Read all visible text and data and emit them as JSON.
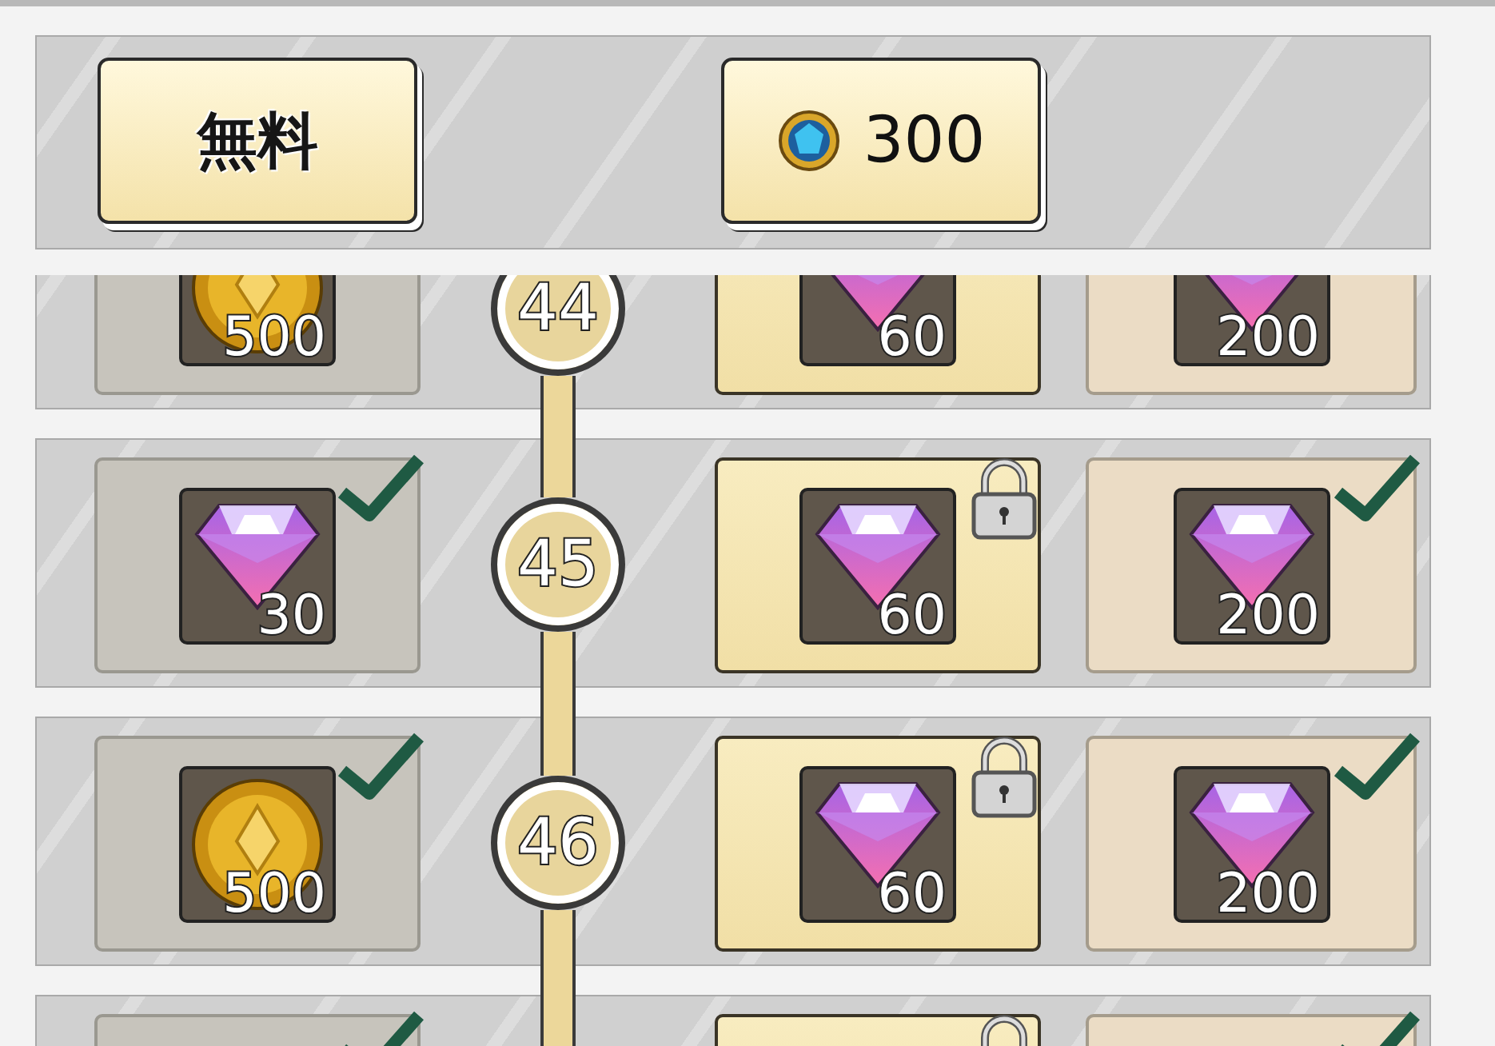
{
  "header": {
    "buttons": [
      {
        "kind": "text",
        "label": "無料"
      },
      {
        "kind": "price",
        "label": "300"
      }
    ]
  },
  "rows": [
    {
      "level": "44",
      "rewards": [
        {
          "kind": "coin",
          "amount": "500"
        },
        {
          "kind": "gem",
          "amount": "60"
        },
        {
          "kind": "gem",
          "amount": "200"
        }
      ]
    },
    {
      "level": "45",
      "rewards": [
        {
          "kind": "gem",
          "amount": "30",
          "claimed": true,
          "locked": false
        },
        {
          "kind": "gem",
          "amount": "60",
          "claimed": false,
          "locked": true
        },
        {
          "kind": "gem",
          "amount": "200",
          "claimed": true,
          "locked": false
        }
      ]
    },
    {
      "level": "46",
      "rewards": [
        {
          "kind": "coin",
          "amount": "500",
          "claimed": true,
          "locked": false
        },
        {
          "kind": "gem",
          "amount": "60",
          "claimed": false,
          "locked": true
        },
        {
          "kind": "gem",
          "amount": "200",
          "claimed": true,
          "locked": false
        }
      ]
    },
    {
      "rewards": [
        {
          "claimed": true,
          "locked": false
        },
        {
          "claimed": false,
          "locked": true
        },
        {
          "claimed": true,
          "locked": false
        }
      ]
    }
  ]
}
